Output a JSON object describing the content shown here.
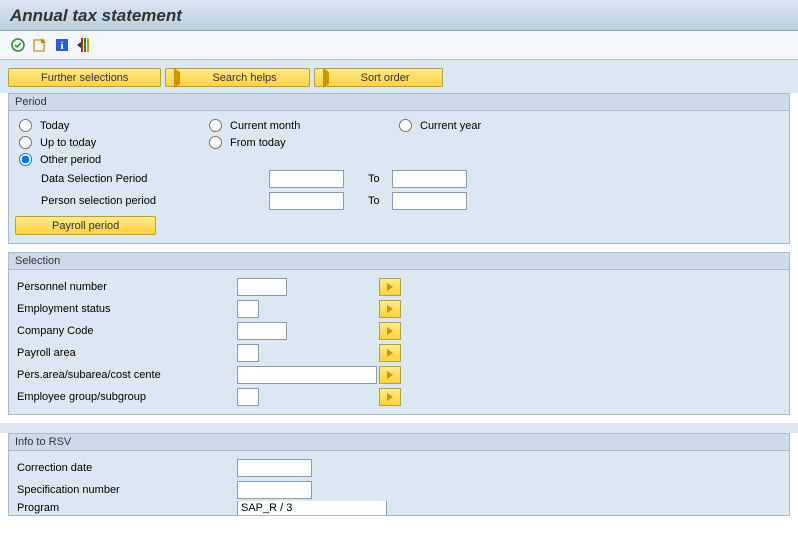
{
  "title": "Annual tax statement",
  "buttons": {
    "further_selections": "Further selections",
    "search_helps": "Search helps",
    "sort_order": "Sort order",
    "payroll_period": "Payroll period"
  },
  "period": {
    "group_label": "Period",
    "today": "Today",
    "current_month": "Current month",
    "current_year": "Current year",
    "up_to_today": "Up to today",
    "from_today": "From today",
    "other_period": "Other period",
    "data_selection_period": "Data Selection Period",
    "person_selection_period": "Person selection period",
    "to": "To",
    "data_sel_from": "",
    "data_sel_to": "",
    "person_sel_from": "",
    "person_sel_to": ""
  },
  "selection": {
    "group_label": "Selection",
    "personnel_number": "Personnel number",
    "employment_status": "Employment status",
    "company_code": "Company Code",
    "payroll_area": "Payroll area",
    "pers_area": "Pers.area/subarea/cost cente",
    "employee_group": "Employee group/subgroup",
    "vals": {
      "personnel_number": "",
      "employment_status": "",
      "company_code": "",
      "payroll_area": "",
      "pers_area": "",
      "employee_group": ""
    }
  },
  "info_rsv": {
    "group_label": "Info to RSV",
    "correction_date": "Correction date",
    "specification_number": "Specification number",
    "program": "Program",
    "vals": {
      "correction_date": "",
      "specification_number": "",
      "program": "SAP_R / 3"
    }
  }
}
